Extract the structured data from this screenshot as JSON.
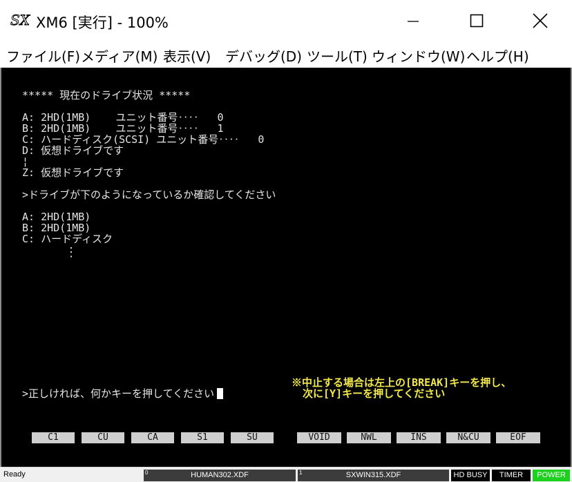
{
  "window": {
    "title": "XM6 [実行] - 100%",
    "icons": {
      "logo": "sx-logo",
      "minimize": "minimize-icon",
      "maximize": "maximize-icon",
      "close": "close-icon"
    }
  },
  "menu": {
    "file": "ファイル(F)",
    "media": "メディア(M)",
    "view": "表示(V)",
    "debug": "デバッグ(D)",
    "tools": "ツール(T)",
    "window": "ウィンドウ(W)",
    "help": "ヘルプ(H)"
  },
  "screen": {
    "heading": "***** 現在のドライブ状況 *****",
    "drives": [
      "A: 2HD(1MB)    ユニット番号‥‥   0",
      "B: 2HD(1MB)    ユニット番号‥‥   1",
      "C: ハードディスク(SCSI) ユニット番号‥‥   0",
      "D: 仮想ドライブです"
    ],
    "ellipsis": "¦",
    "drive_z": "Z: 仮想ドライブです",
    "confirm_prompt": ">ドライブが下のようになっているか確認してください",
    "expected": [
      "A: 2HD(1MB)",
      "B: 2HD(1MB)",
      "C: ハードディスク"
    ],
    "vertical_ellipsis": "⋮",
    "press_key_prompt": ">正しければ、何かキーを押してください",
    "warning_line1": "※中止する場合は左上の[BREAK]キーを押し、",
    "warning_line2": "次に[Y]キーを押してください",
    "colors": {
      "background": "#000000",
      "text": "#e6e6e6",
      "warning": "#f2e84a"
    }
  },
  "function_keys": [
    "C1",
    "CU",
    "CA",
    "S1",
    "SU",
    "VOID",
    "NWL",
    "INS",
    "N&CU",
    "EOF"
  ],
  "status": {
    "ready": "Ready",
    "drive0_num": "0",
    "drive0": "HUMAN302.XDF",
    "drive1_num": "1",
    "drive1": "SXWIN315.XDF",
    "hd_busy": "HD BUSY",
    "timer": "TIMER",
    "power": "POWER",
    "colors": {
      "power": "#1fd11f",
      "indicator": "#000000"
    }
  }
}
